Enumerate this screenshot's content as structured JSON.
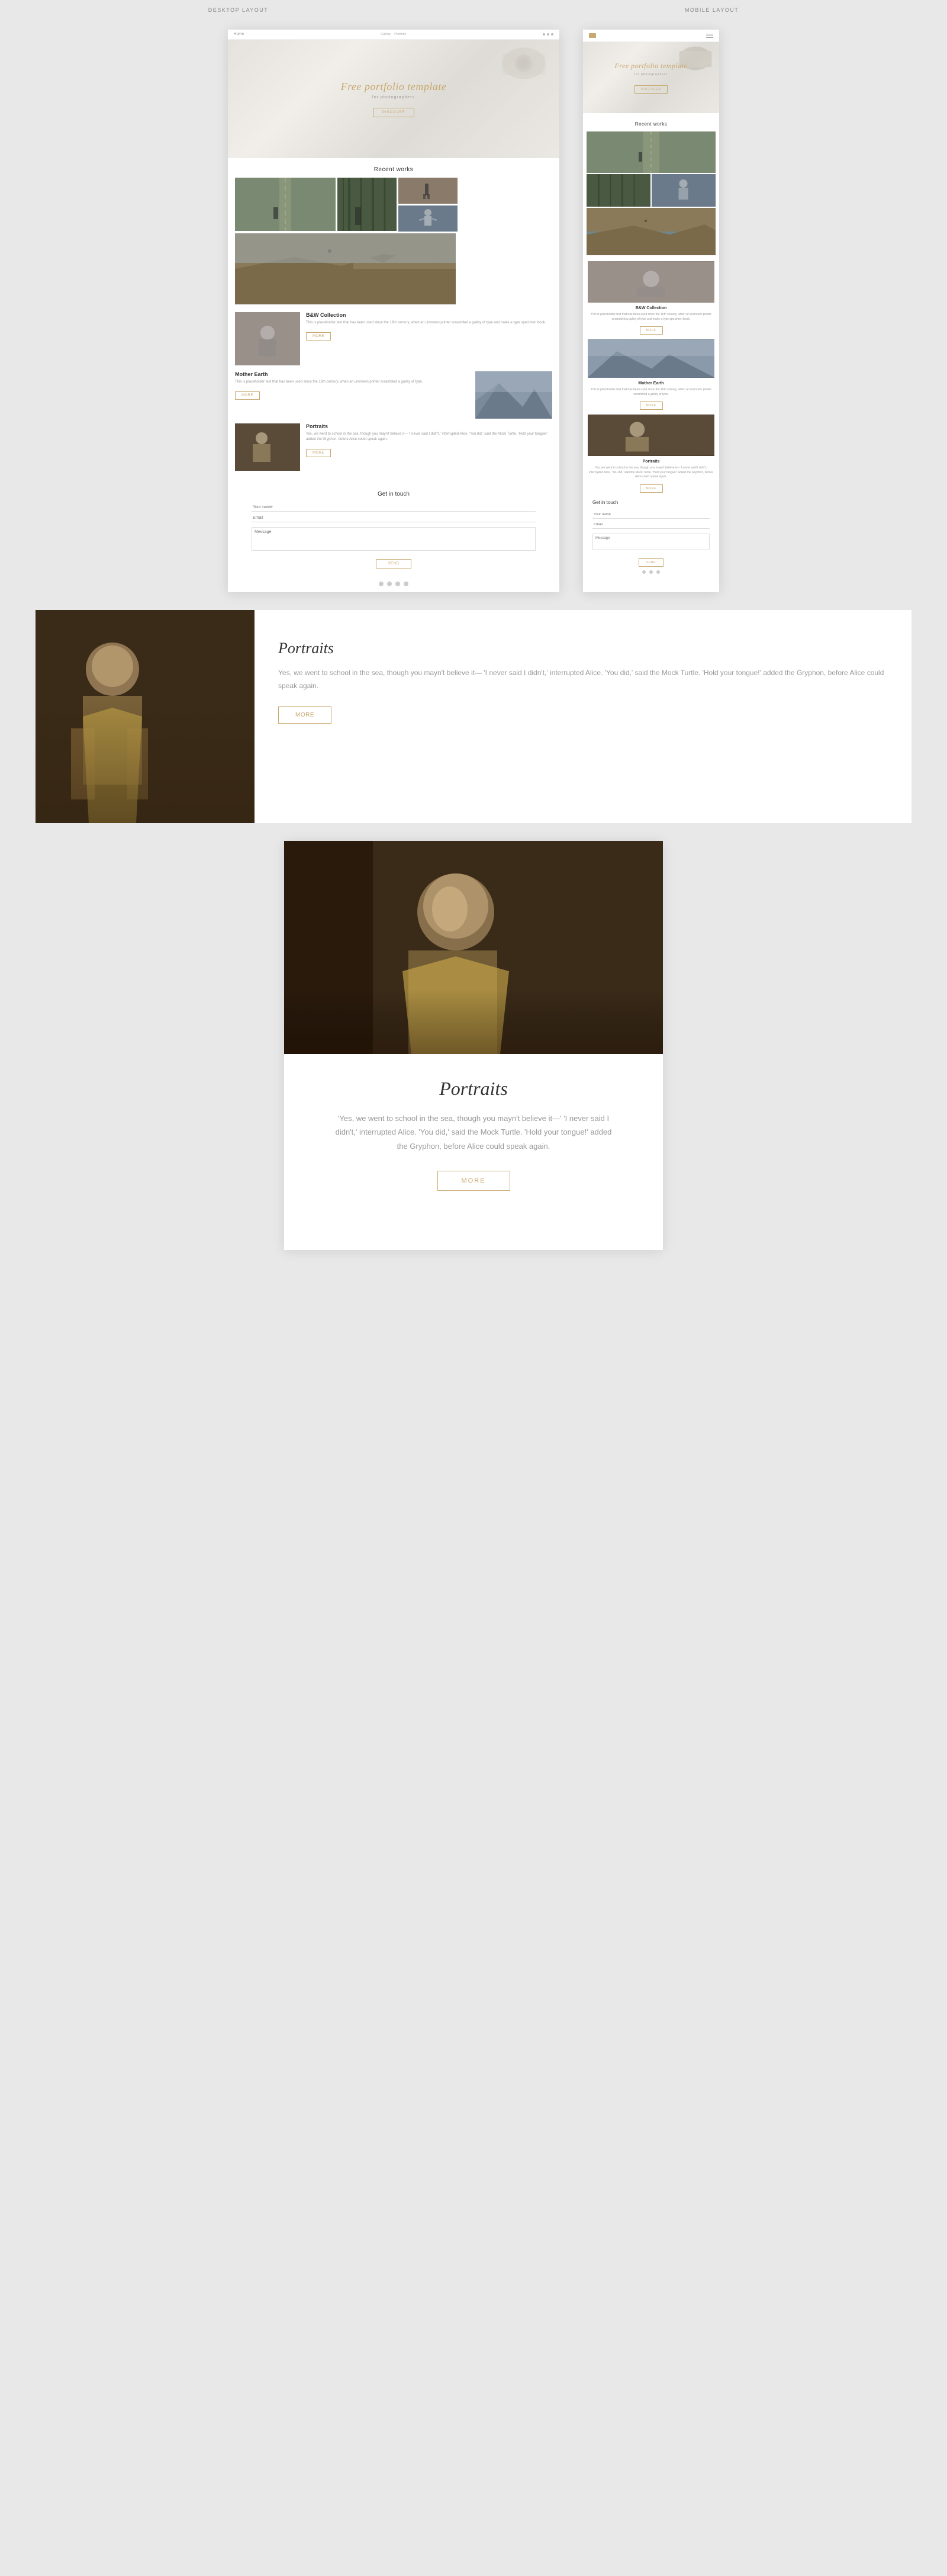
{
  "labels": {
    "desktop": "DESKTOP LAYOUT",
    "mobile": "MOBILE LAYOUT"
  },
  "nav": {
    "logo": "Home",
    "links": [
      "Gallery",
      "Portfolio"
    ],
    "discover": "DISCOVER"
  },
  "hero": {
    "title": "Free portfolio template",
    "subtitle": "for photographers",
    "btn": "DISCOVER"
  },
  "recent_works": {
    "title": "Recent works"
  },
  "sections": {
    "bw_collection": {
      "title": "B&W Collection",
      "desc": "This is placeholder text that has been used since the 16th century, when an unknown printer scrambled a galley of type and make a type specimen book.",
      "btn": "MORE"
    },
    "mother_earth": {
      "title": "Mother Earth",
      "desc": "This is placeholder text that has been used since the 16th century, when an unknown printer scrambled a galley of type.",
      "btn": "MORE"
    },
    "portraits": {
      "title": "Portraits",
      "desc": "Yes, we went to school in the sea, though you mayn't believe it— 'I never said I didn't,' interrupted Alice. 'You did,' said the Mock Turtle. 'Hold your tongue!' added the Gryphon, before Alice could speak again.",
      "btn": "MORE"
    }
  },
  "contact": {
    "title": "Get in touch",
    "name_placeholder": "Your name",
    "email_placeholder": "Email",
    "message_placeholder": "Message",
    "submit": "SEND"
  },
  "large_page": {
    "title": "Portraits",
    "desc": "'Yes, we went to school in the sea, though you mayn't believe it—' 'I never said I didn't,' interrupted Alice. 'You did,' said the Mock Turtle. 'Hold your tongue!' added the Gryphon, before Alice could speak again.",
    "btn": "MORE"
  }
}
